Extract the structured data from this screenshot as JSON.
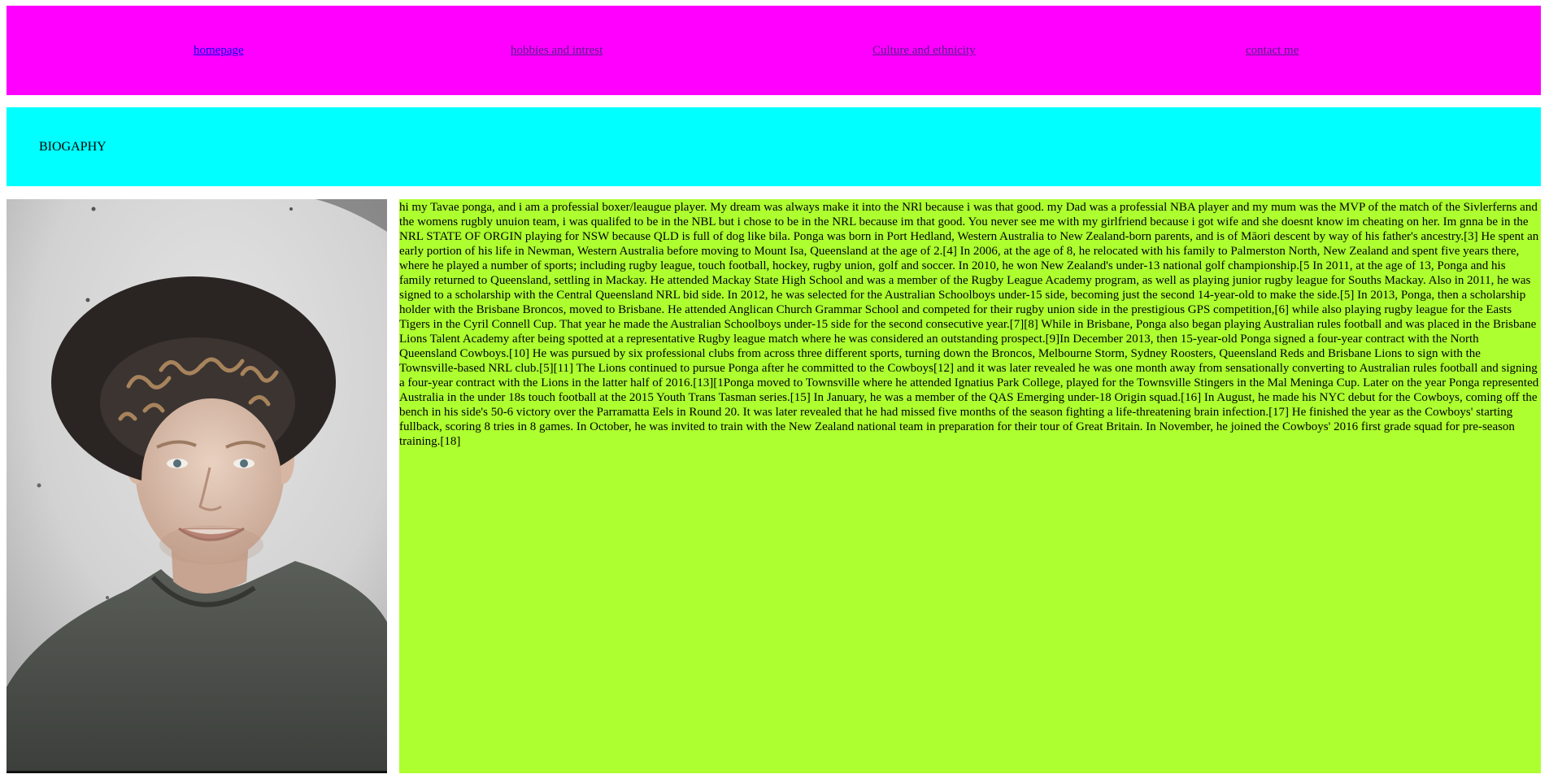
{
  "nav": {
    "items": [
      {
        "label": "homepage"
      },
      {
        "label": "hobbies and intrest"
      },
      {
        "label": "Culture and ethnicity"
      },
      {
        "label": "contact me"
      }
    ]
  },
  "banner": {
    "title": "BIOGAPHY"
  },
  "photo": {
    "subject": "portrait of a smiling young man with curly hair wearing a black hat and dark t-shirt"
  },
  "bio": {
    "text": "hi my Tavae ponga, and i am a professial boxer/leaugue player. My dream was always make it into the NRl because i was that good. my Dad was a professial NBA player and my mum was the MVP of the match of the Sivlerferns and the womens rugbly unuion team, i was qualifed to be in the NBL but i chose to be in the NRL because im that good. You never see me with my girlfriend because i got wife and she doesnt know im cheating on her. Im gnna be in the NRL STATE OF ORGIN playing for NSW because QLD is full of dog like bila. Ponga was born in Port Hedland, Western Australia to New Zealand-born parents, and is of Māori descent by way of his father's ancestry.[3] He spent an early portion of his life in Newman, Western Australia before moving to Mount Isa, Queensland at the age of 2.[4] In 2006, at the age of 8, he relocated with his family to Palmerston North, New Zealand and spent five years there, where he played a number of sports; including rugby league, touch football, hockey, rugby union, golf and soccer. In 2010, he won New Zealand's under-13 national golf championship.[5 In 2011, at the age of 13, Ponga and his family returned to Queensland, settling in Mackay. He attended Mackay State High School and was a member of the Rugby League Academy program, as well as playing junior rugby league for Souths Mackay. Also in 2011, he was signed to a scholarship with the Central Queensland NRL bid side. In 2012, he was selected for the Australian Schoolboys under-15 side, becoming just the second 14-year-old to make the side.[5] In 2013, Ponga, then a scholarship holder with the Brisbane Broncos, moved to Brisbane. He attended Anglican Church Grammar School and competed for their rugby union side in the prestigious GPS competition,[6] while also playing rugby league for the Easts Tigers in the Cyril Connell Cup. That year he made the Australian Schoolboys under-15 side for the second consecutive year.[7][8] While in Brisbane, Ponga also began playing Australian rules football and was placed in the Brisbane Lions Talent Academy after being spotted at a representative Rugby league match where he was considered an outstanding prospect.[9]In December 2013, then 15-year-old Ponga signed a four-year contract with the North Queensland Cowboys.[10] He was pursued by six professional clubs from across three different sports, turning down the Broncos, Melbourne Storm, Sydney Roosters, Queensland Reds and Brisbane Lions to sign with the Townsville-based NRL club.[5][11] The Lions continued to pursue Ponga after he committed to the Cowboys[12] and it was later revealed he was one month away from sensationally converting to Australian rules football and signing a four-year contract with the Lions in the latter half of 2016.[13][1Ponga moved to Townsville where he attended Ignatius Park College, played for the Townsville Stingers in the Mal Meninga Cup. Later on the year Ponga represented Australia in the under 18s touch football at the 2015 Youth Trans Tasman series.[15] In January, he was a member of the QAS Emerging under-18 Origin squad.[16] In August, he made his NYC debut for the Cowboys, coming off the bench in his side's 50-6 victory over the Parramatta Eels in Round 20. It was later revealed that he had missed five months of the season fighting a life-threatening brain infection.[17] He finished the year as the Cowboys' starting fullback, scoring 8 tries in 8 games. In October, he was invited to train with the New Zealand national team in preparation for their tour of Great Britain. In November, he joined the Cowboys' 2016 first grade squad for pre-season training.[18]"
  },
  "colors": {
    "nav_bg": "#ff00ff",
    "banner_bg": "#00ffff",
    "bio_bg": "#adff2f",
    "link_unvisited": "#0000ee",
    "link_visited": "#551a8b"
  }
}
